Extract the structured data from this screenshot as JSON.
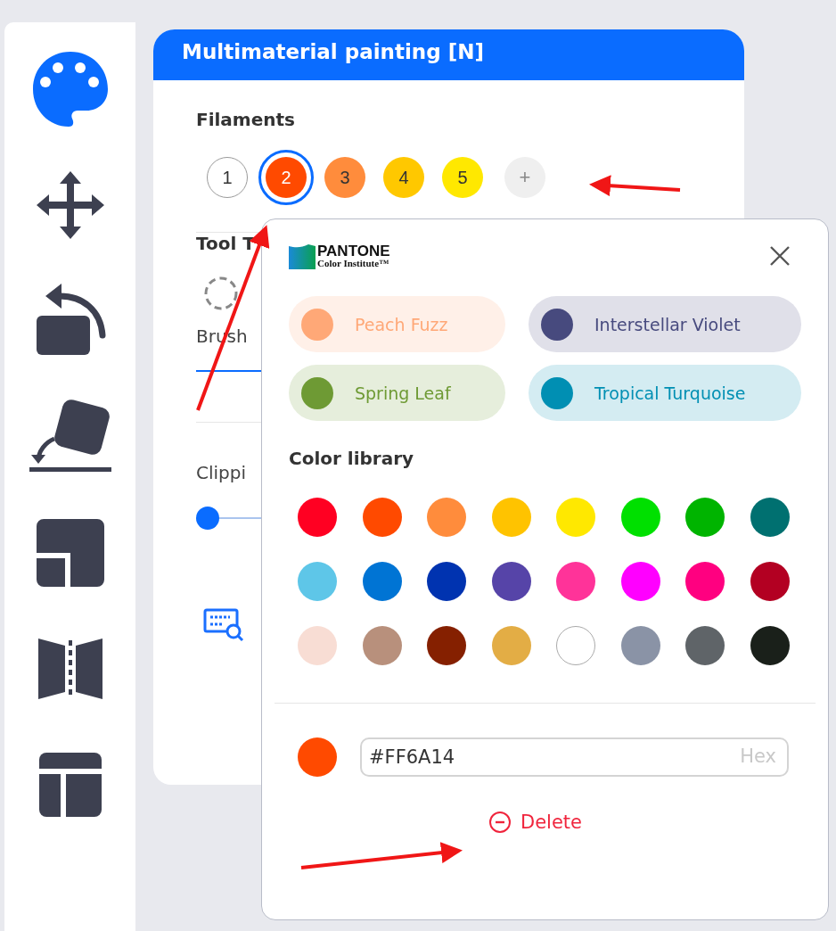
{
  "sidebar": {
    "items": [
      {
        "kind": "palette",
        "selected": true
      },
      {
        "kind": "move",
        "selected": false
      },
      {
        "kind": "rotate",
        "selected": false
      },
      {
        "kind": "place",
        "selected": false
      },
      {
        "kind": "layout",
        "selected": false
      },
      {
        "kind": "cut",
        "selected": false
      },
      {
        "kind": "table",
        "selected": false
      }
    ]
  },
  "panel": {
    "title": "Multimaterial painting [N]",
    "filaments_label": "Filaments",
    "filaments": [
      {
        "label": "1",
        "color": "#ffffff",
        "selected": false
      },
      {
        "label": "2",
        "color": "#ff4a00",
        "selected": true
      },
      {
        "label": "3",
        "color": "#ff8c3c",
        "selected": false
      },
      {
        "label": "4",
        "color": "#ffc800",
        "selected": false
      },
      {
        "label": "5",
        "color": "#ffe800",
        "selected": false
      }
    ],
    "add_label": "+",
    "tool_type_label": "Tool T",
    "brush_label": "Brush",
    "clipping_label": "Clippi",
    "clipping": {
      "level": 0.0
    }
  },
  "popup": {
    "brand": "PANTONE",
    "brand_subtitle": "Color Institute™",
    "pantone_colors": [
      {
        "name": "Peach Fuzz",
        "color": "#ffa877"
      },
      {
        "name": "Interstellar Violet",
        "color": "#474a7e"
      },
      {
        "name": "Spring Leaf",
        "color": "#6e9a34"
      },
      {
        "name": "Tropical Turquoise",
        "color": "#008fb3"
      }
    ],
    "library_label": "Color library",
    "library": [
      {
        "color": "#ff0022"
      },
      {
        "color": "#ff4a00"
      },
      {
        "color": "#ff8c3c"
      },
      {
        "color": "#ffc300"
      },
      {
        "color": "#ffe800"
      },
      {
        "color": "#00e000"
      },
      {
        "color": "#00b400"
      },
      {
        "color": "#007070"
      },
      {
        "color": "#5ec6e8"
      },
      {
        "color": "#0074d4"
      },
      {
        "color": "#0033b0"
      },
      {
        "color": "#5644a8"
      },
      {
        "color": "#ff3399"
      },
      {
        "color": "#ff00ff"
      },
      {
        "color": "#ff0080"
      },
      {
        "color": "#b30022"
      },
      {
        "color": "#f8ddd4"
      },
      {
        "color": "#b8907c"
      },
      {
        "color": "#852000"
      },
      {
        "color": "#e3ad45"
      },
      {
        "color": "#ffffff"
      },
      {
        "color": "#8a93a6"
      },
      {
        "color": "#5f6468"
      },
      {
        "color": "#1a201a"
      }
    ],
    "current": {
      "color": "#ff4a00"
    },
    "hex_value": "#FF6A14",
    "hex_suffix": "Hex",
    "delete_label": "Delete"
  }
}
